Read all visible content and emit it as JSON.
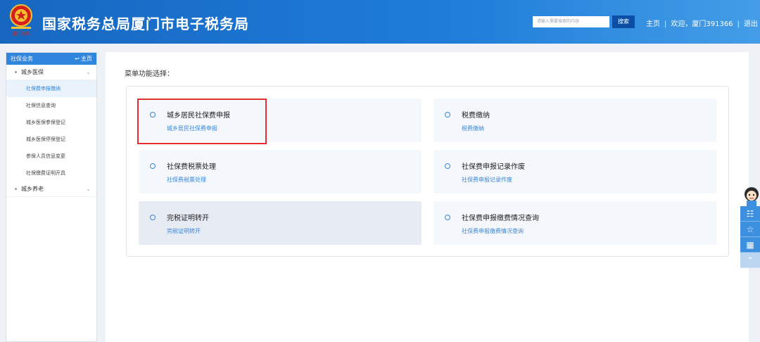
{
  "header": {
    "site_title": "国家税务总局厦门市电子税务局",
    "search_placeholder": "请输入需要搜索的内容",
    "search_button": "搜索",
    "home_link": "主页",
    "welcome_text": "欢迎，厦门391366",
    "logout_link": "退出",
    "emblem_caption": "厦门税务"
  },
  "sidebar": {
    "title": "社保业务",
    "home_link": "主页",
    "groups": [
      {
        "label": "城乡医保",
        "items": [
          {
            "label": "社保费申报缴纳",
            "active": true
          },
          {
            "label": "社保信息查询"
          },
          {
            "label": "城乡医保参保登记"
          },
          {
            "label": "城乡医保停保登记"
          },
          {
            "label": "参保人员信息变更"
          },
          {
            "label": "社保缴费证明开具"
          }
        ]
      },
      {
        "label": "城乡养老",
        "items": []
      }
    ]
  },
  "main": {
    "section_label": "菜单功能选择：",
    "cards": [
      {
        "title": "城乡居民社保费申报",
        "subtitle": "城乡居民社保费申报"
      },
      {
        "title": "税费缴纳",
        "subtitle": "税费缴纳"
      },
      {
        "title": "社保费税票处理",
        "subtitle": "社保费税票处理"
      },
      {
        "title": "社保费申报记录作废",
        "subtitle": "社保费申报记录作废"
      },
      {
        "title": "完税证明转开",
        "subtitle": "完税证明转开"
      },
      {
        "title": "社保费申报缴费情况查询",
        "subtitle": "社保费申报缴费情况查询"
      }
    ]
  },
  "side_tools": {
    "icons": [
      "id-card-icon",
      "star-icon",
      "calendar-icon",
      "arrow-up-icon"
    ]
  },
  "colors": {
    "header_blue": "#1d79d6",
    "accent_blue": "#3a86d8",
    "highlight_red": "#e23030"
  }
}
